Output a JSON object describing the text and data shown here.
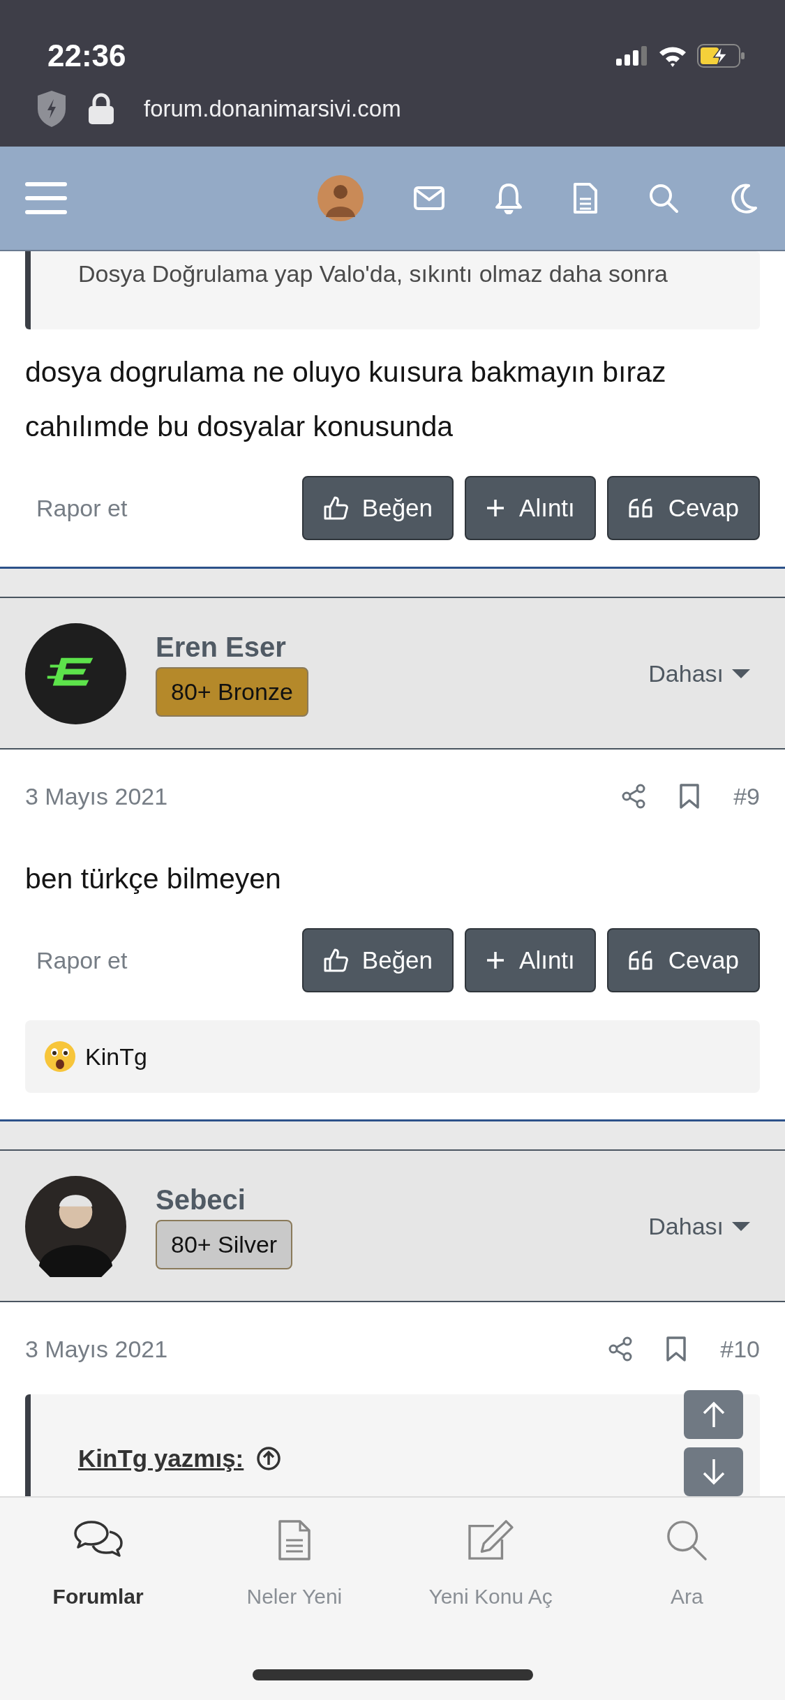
{
  "status_bar": {
    "time": "22:36"
  },
  "browser": {
    "url": "forum.donanimarsivi.com"
  },
  "posts": [
    {
      "quote": {
        "text": "Dosya Doğrulama yap Valo'da, sıkıntı olmaz daha sonra"
      },
      "body": "dosya dogrulama ne oluyo kuısura bakmayın bıraz cahılımde bu dosyalar konusunda",
      "report": "Rapor et",
      "actions": [
        {
          "kind": "like",
          "label": "Beğen"
        },
        {
          "kind": "quote",
          "label": "Alıntı"
        },
        {
          "kind": "reply",
          "label": "Cevap"
        }
      ]
    },
    {
      "author": "Eren Eser",
      "badge": {
        "label": "80+ Bronze",
        "color": "#b5892a"
      },
      "more": "Dahası",
      "date": "3 Mayıs 2021",
      "number": "#9",
      "body": "ben türkçe bilmeyen",
      "report": "Rapor et",
      "actions": [
        {
          "kind": "like",
          "label": "Beğen"
        },
        {
          "kind": "quote",
          "label": "Alıntı"
        },
        {
          "kind": "reply",
          "label": "Cevap"
        }
      ],
      "reactions": {
        "users": "KinTg"
      }
    },
    {
      "author": "Sebeci",
      "badge": {
        "label": "80+ Silver",
        "color": "#c9c9c9"
      },
      "more": "Dahası",
      "date": "3 Mayıs 2021",
      "number": "#10",
      "quote": {
        "attribution": "KinTg yazmış:"
      }
    }
  ],
  "tab_bar": [
    {
      "kind": "forums",
      "label": "Forumlar",
      "selected": true
    },
    {
      "kind": "new",
      "label": "Neler Yeni",
      "selected": false
    },
    {
      "kind": "post",
      "label": "Yeni Konu Aç",
      "selected": false
    },
    {
      "kind": "search",
      "label": "Ara",
      "selected": false
    }
  ]
}
